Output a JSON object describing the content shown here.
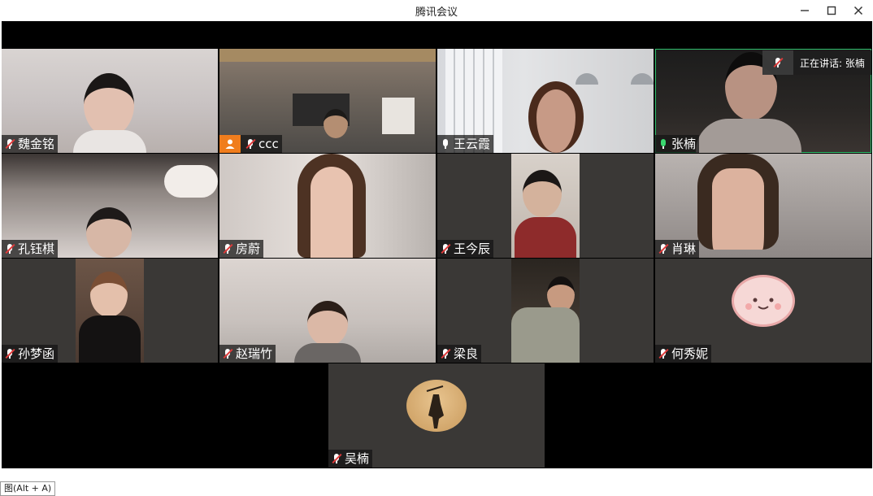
{
  "window": {
    "title": "腾讯会议"
  },
  "speaking": {
    "label": "正在讲话: 张楠"
  },
  "participants": [
    {
      "name": "魏金铭",
      "mic": "muted"
    },
    {
      "name": "ccc",
      "mic": "muted",
      "host": true
    },
    {
      "name": "王云霞",
      "mic": "unmuted-white"
    },
    {
      "name": "张楠",
      "mic": "speaking"
    },
    {
      "name": "孔钰棋",
      "mic": "muted"
    },
    {
      "name": "房蔚",
      "mic": "muted"
    },
    {
      "name": "王今辰",
      "mic": "muted"
    },
    {
      "name": "肖琳",
      "mic": "muted"
    },
    {
      "name": "孙梦函",
      "mic": "muted"
    },
    {
      "name": "赵瑞竹",
      "mic": "muted"
    },
    {
      "name": "梁良",
      "mic": "muted"
    },
    {
      "name": "何秀妮",
      "mic": "muted"
    },
    {
      "name": "吴楠",
      "mic": "muted"
    }
  ],
  "footer": {
    "tooltip": "图(Alt + A)"
  },
  "colors": {
    "active_border": "#2fbf6b",
    "host_badge": "#f07d1d",
    "mic_muted_slash": "#e03a3a",
    "mic_on": "#3ad66f"
  },
  "icons": [
    "minimize-icon",
    "maximize-icon",
    "close-icon",
    "mic-muted-icon",
    "mic-icon",
    "host-icon"
  ]
}
